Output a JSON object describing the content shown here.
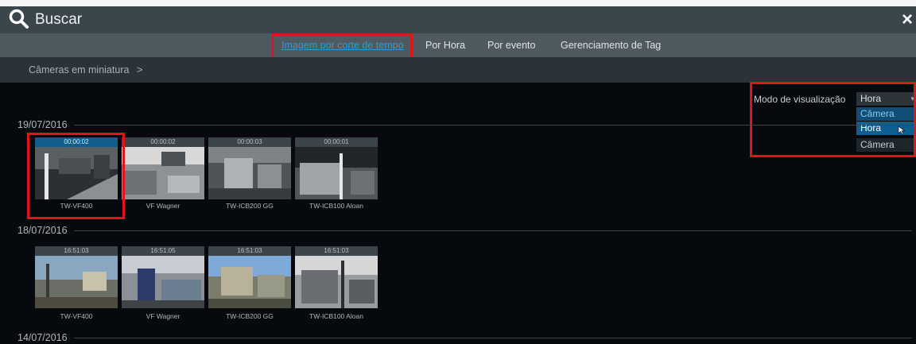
{
  "header": {
    "title": "Buscar",
    "close_symbol": "×"
  },
  "tabs": [
    {
      "label": "Imagem por corte de tempo",
      "active": true
    },
    {
      "label": "Por Hora",
      "active": false
    },
    {
      "label": "Por evento",
      "active": false
    },
    {
      "label": "Gerenciamento de Tag",
      "active": false
    }
  ],
  "breadcrumb": {
    "label": "Câmeras em miniatura",
    "arrow": ">"
  },
  "view_mode": {
    "label": "Modo de visualização",
    "selected": "Hora",
    "options": [
      "Câmera",
      "Hora",
      "Câmera"
    ]
  },
  "groups": [
    {
      "date": "19/07/2016",
      "thumbs": [
        {
          "time": "00:00:02",
          "camera": "TW-VF400",
          "selected": true
        },
        {
          "time": "00:00:02",
          "camera": "VF Wagner"
        },
        {
          "time": "00:00:03",
          "camera": "TW-ICB200 GG"
        },
        {
          "time": "00:00:01",
          "camera": "TW-ICB100 Aloan"
        }
      ]
    },
    {
      "date": "18/07/2016",
      "thumbs": [
        {
          "time": "16:51:03",
          "camera": "TW-VF400"
        },
        {
          "time": "16:51:05",
          "camera": "VF Wagner"
        },
        {
          "time": "16:51:03",
          "camera": "TW-ICB200 GG"
        },
        {
          "time": "16:51:03",
          "camera": "TW-ICB100 Aloan"
        }
      ]
    },
    {
      "date": "14/07/2016"
    }
  ],
  "colors": {
    "highlight": "#e0141b",
    "active_tab": "#2e9ad8",
    "accent": "#0e5f90"
  }
}
